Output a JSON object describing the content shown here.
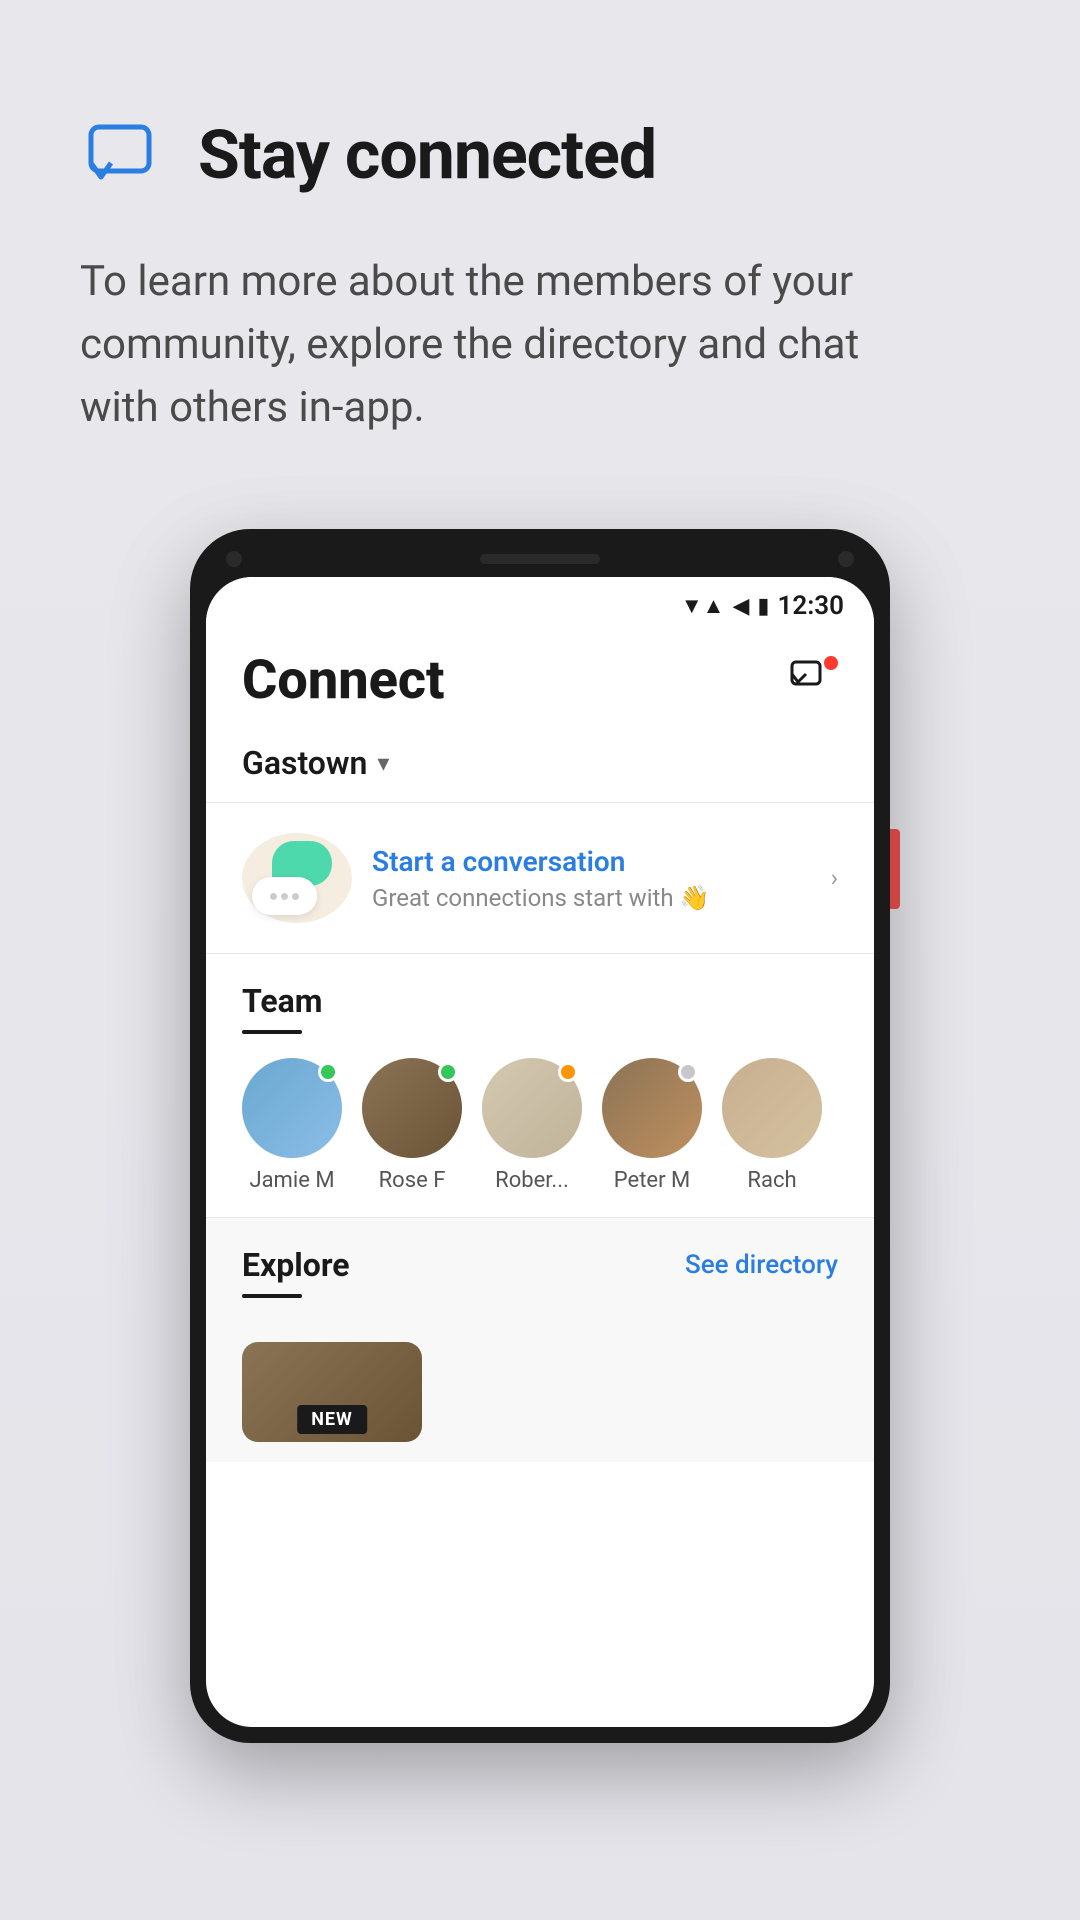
{
  "page": {
    "background_color": "#e8e8ec"
  },
  "header": {
    "icon_label": "chat-icon",
    "title": "Stay connected",
    "description": "To learn more about the members of your community, explore the directory and chat with others in-app."
  },
  "phone": {
    "status_bar": {
      "time": "12:30",
      "wifi_icon": "wifi",
      "signal_icon": "signal",
      "battery_icon": "battery"
    },
    "app": {
      "title": "Connect",
      "notification_label": "messages-icon"
    },
    "community": {
      "name": "Gastown",
      "chevron": "▾"
    },
    "start_conversation": {
      "title": "Start a conversation",
      "subtitle": "Great connections start with 👋",
      "arrow": "›"
    },
    "team": {
      "section_title": "Team",
      "members": [
        {
          "name": "Jamie M",
          "status": "green"
        },
        {
          "name": "Rose F",
          "status": "green"
        },
        {
          "name": "Rober...",
          "status": "orange"
        },
        {
          "name": "Peter M",
          "status": "gray"
        },
        {
          "name": "Rach",
          "status": "none"
        }
      ]
    },
    "explore": {
      "section_title": "Explore",
      "see_directory_label": "See directory",
      "new_badge": "NEW"
    }
  }
}
